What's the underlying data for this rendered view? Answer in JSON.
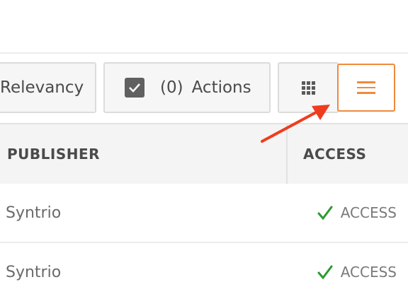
{
  "toolbar": {
    "sort_label": "Relevancy",
    "actions_count": "(0)",
    "actions_label": "Actions",
    "grid_view_icon": "grid-icon",
    "list_view_icon": "list-icon",
    "list_view_color": "#f08a3c"
  },
  "table": {
    "columns": [
      "PUBLISHER",
      "ACCESS"
    ],
    "rows": [
      {
        "publisher": "Syntrio",
        "access": "ACCESS"
      },
      {
        "publisher": "Syntrio",
        "access": "ACCESS"
      }
    ]
  },
  "colors": {
    "accent": "#f08a3c",
    "arrow": "#f03c1e",
    "check": "#2e9a2e"
  }
}
